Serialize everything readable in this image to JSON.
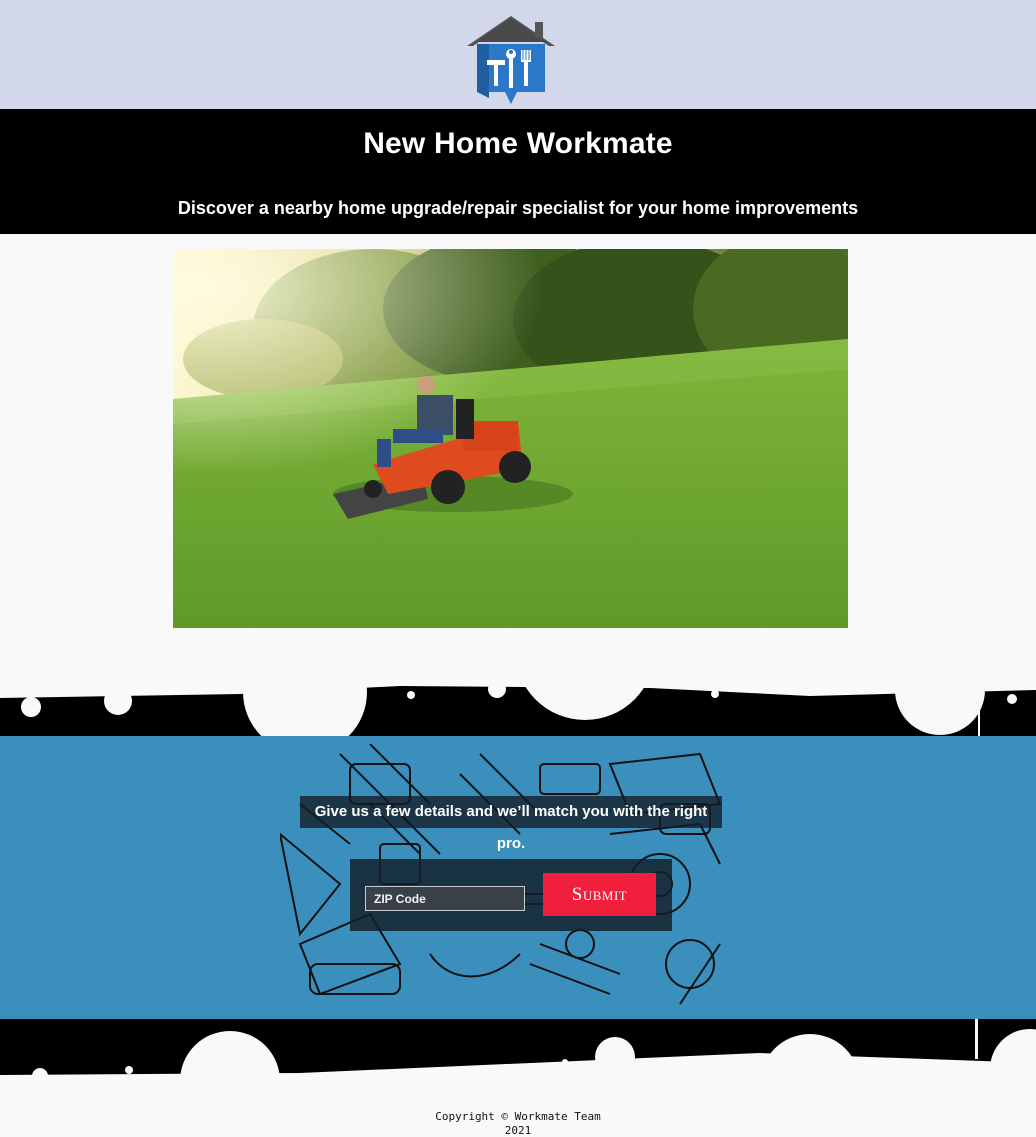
{
  "brand": {
    "logo_icon": "house-tools-logo-icon",
    "accent_color": "#2b78c8"
  },
  "hero": {
    "title": "New Home Workmate",
    "tagline": "Discover a nearby home upgrade/repair specialist for your home improvements"
  },
  "photo": {
    "subject": "man riding lawn mower on grass"
  },
  "form": {
    "heading": "Give us a few details and we’ll match you with the right pro.",
    "zip_placeholder": "ZIP Code",
    "zip_value": "",
    "submit_label": "Submit",
    "band_color": "#3a8fbc",
    "submit_color": "#f01f3c"
  },
  "footer": {
    "copyright": "Copyright © Workmate Team",
    "year": "2021"
  }
}
